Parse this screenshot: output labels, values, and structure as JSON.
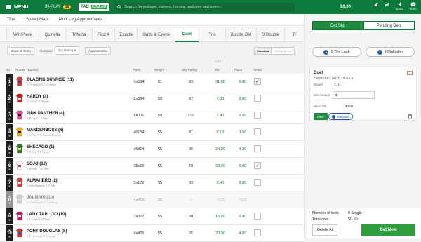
{
  "topbar": {
    "menu_label": "MENU",
    "inplay_label": "IN-PLAY",
    "inplay_count": "19",
    "logo_main": "TAB",
    "logo_sub": "COM.AU",
    "search_placeholder": "Search for jockeys, trainers, horses, matches and more...",
    "balance": "$0.00",
    "icons": [
      {
        "name": "horse-racing-icon",
        "label": ""
      },
      {
        "name": "greyhound-icon",
        "label": ""
      },
      {
        "name": "audio-icon",
        "label": "AUDIO"
      },
      {
        "name": "video-icon",
        "label": "VIDEO"
      }
    ]
  },
  "subnav": {
    "items": [
      "Tips",
      "Speed Map",
      "Multi Leg Approximates"
    ]
  },
  "bet_tabs": [
    {
      "label": "Win/Place",
      "active": false
    },
    {
      "label": "Quinella",
      "active": false
    },
    {
      "label": "Trifecta",
      "active": false
    },
    {
      "label": "First 4",
      "active": false
    },
    {
      "label": "Exacta",
      "active": false
    },
    {
      "label": "Odds & Evens",
      "active": false
    },
    {
      "label": "Duet",
      "active": true
    },
    {
      "label": "Trio",
      "active": false
    },
    {
      "label": "Bundle Bet",
      "active": false
    },
    {
      "label": "D Double",
      "active": false
    },
    {
      "label": "Tr",
      "active": false
    }
  ],
  "filters": {
    "show_all_form": "Show All Form",
    "compare_label": "Compare",
    "compare_value": "Sky Rating",
    "approximates": "Approximates",
    "standout": "Standout",
    "boxing": "Boxing Button"
  },
  "table": {
    "tote_label": "TOTE",
    "headers": {
      "no": "No.",
      "runner": "Runner (Barrier)",
      "form": "Form",
      "weight": "Weight",
      "sky": "Sky Rating",
      "win": "Win",
      "place": "Place",
      "select": "Cardbox"
    },
    "rows": [
      {
        "no": "1",
        "name": "BLAZING SUNRISE (11)",
        "sub": "J: J Pracht (a2)  T: G Kirkup",
        "form": "0x534",
        "weight": "61",
        "sky": "93",
        "win": "31.80",
        "place": "6.80",
        "checked": true,
        "scratched": false,
        "silk": [
          "#d93a2f",
          "#2b4aa0"
        ]
      },
      {
        "no": "2",
        "name": "HARDY (3)",
        "sub": "J: J Ford  T: L Pepper",
        "form": "2x324",
        "weight": "59",
        "sky": "97",
        "win": "7.30",
        "place": "2.60",
        "checked": false,
        "scratched": false,
        "silk": [
          "#c81e1e",
          "#ffffff"
        ]
      },
      {
        "no": "3",
        "name": "PINK PANTHER (4)",
        "sub": "J: B Loy  T: L Cleary",
        "form": "64311",
        "weight": "58",
        "sky": "100",
        "win": "2.40",
        "place": "2.50",
        "checked": false,
        "scratched": false,
        "silk": [
          "#e74c9a",
          "#222222"
        ]
      },
      {
        "no": "4",
        "name": "MANDERBOSS (6)",
        "sub": "J: M Pike  T: D Fiucci & M Jones",
        "form": "x6154",
        "weight": "55",
        "sky": "91",
        "win": "6.10",
        "place": "1.50",
        "checked": false,
        "scratched": false,
        "silk": [
          "#f0b21a",
          "#1a1a1a"
        ]
      },
      {
        "no": "5",
        "name": "SHECAGO (1)",
        "sub": "J: R King  T: R Pinner",
        "form": "x5314",
        "weight": "55",
        "sky": "86",
        "win": "24.00",
        "place": "4.30",
        "checked": false,
        "scratched": false,
        "silk": [
          "#2f7a3a",
          "#f0d020"
        ]
      },
      {
        "no": "6",
        "name": "SOJO (12)",
        "sub": "J: B Ryan  T: N Olive",
        "form": "35x15",
        "weight": "55",
        "sky": "79",
        "win": "23.20",
        "place": "5.00",
        "checked": true,
        "scratched": false,
        "silk": [
          "#ffffff",
          "#d02a2a"
        ]
      },
      {
        "no": "7",
        "name": "ALMAHERO (2)",
        "sub": "J: Ken Swerwein  T: S Seib",
        "form": "3x172",
        "weight": "55",
        "sky": "83",
        "win": "9.40",
        "place": "2.60",
        "checked": false,
        "scratched": false,
        "silk": [
          "#e53935",
          "#ffffff"
        ]
      },
      {
        "no": "8",
        "name": "JALMARI (10)",
        "sub": "J: Paul Neilson  T: N Williams",
        "form": "4x412",
        "weight": "55",
        "sky": "--",
        "win": "SCR",
        "place": "SCR",
        "checked": false,
        "scratched": true,
        "silk": [
          "#9e9e9e",
          "#d0d0d0"
        ]
      },
      {
        "no": "9",
        "name": "LADY TABLOID (10)",
        "sub": "J: A Collett  T: N Olive",
        "form": "7x327",
        "weight": "55",
        "sky": "88",
        "win": "16.80",
        "place": "2.80",
        "checked": false,
        "scratched": false,
        "silk": [
          "#c2185b",
          "#ffffff"
        ]
      },
      {
        "no": "10",
        "name": "PORT DOUGLAS (8)",
        "sub": "J: E Hennessy  T: S Herley",
        "form": "0x405",
        "weight": "55",
        "sky": "65",
        "win": "20.90",
        "place": "4.60",
        "checked": false,
        "scratched": false,
        "silk": [
          "#d32f2f",
          "#1565c0"
        ]
      }
    ]
  },
  "betslip": {
    "tab_betslip": "Bet Slip",
    "tab_pending": "Pending Bets",
    "the_lock": "1 The Lock",
    "multiplier": "1 Multiplier",
    "lock_badge": "1",
    "multi_badge": "1",
    "card": {
      "title": "Duet",
      "subtitle": "CANBERRA (ACT) - Race 9",
      "boxed_label": "Boxed",
      "boxed_value": "1, 6",
      "amount_label": "Bet Amount",
      "amount_value": "$",
      "cost_label": "Bet Cost",
      "cost_value": "$0.00",
      "flexi": "Flexi",
      "multiplier_btn": "Multiplier"
    },
    "summary": {
      "num_bets_label": "Number of bets",
      "num_bets_value": "0 Single",
      "total_label": "Total cost",
      "total_value": "$0.00",
      "delete_all": "Delete All",
      "bet_now": "Bet Now"
    }
  }
}
